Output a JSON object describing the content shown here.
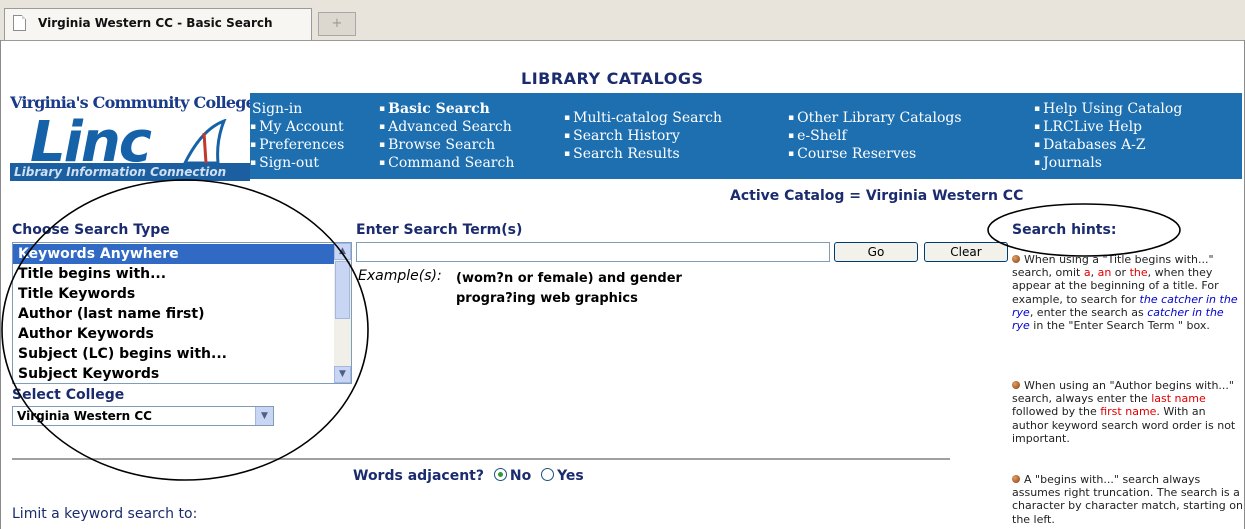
{
  "browser": {
    "tab_title": "Virginia Western CC - Basic Search",
    "new_tab": "+"
  },
  "logo": {
    "org": "Virginia's Community Colleges",
    "brand": "Linc",
    "tagline": "Library Information Connection"
  },
  "heading": "LIBRARY CATALOGS",
  "nav": {
    "col1": [
      "Sign-in",
      "My Account",
      "Preferences",
      "Sign-out"
    ],
    "col2": [
      "Basic Search",
      "Advanced Search",
      "Browse Search",
      "Command Search"
    ],
    "col3": [
      "Multi-catalog Search",
      "Search History",
      "Search Results"
    ],
    "col4": [
      "Other Library Catalogs",
      "e-Shelf",
      "Course Reserves"
    ],
    "col5": [
      "Help Using Catalog",
      "LRCLive Help",
      "Databases A-Z",
      "Journals"
    ]
  },
  "active_catalog": "Active Catalog = Virginia Western CC",
  "search_type": {
    "label": "Choose Search Type",
    "options": [
      "Keywords Anywhere",
      "Title begins with...",
      "Title Keywords",
      "Author (last name first)",
      "Author Keywords",
      "Subject (LC) begins with...",
      "Subject Keywords"
    ],
    "selected": "Keywords Anywhere"
  },
  "college": {
    "label": "Select College",
    "selected": "Virginia Western CC"
  },
  "search_term": {
    "label": "Enter Search Term(s)",
    "value": "",
    "go": "Go",
    "clear": "Clear"
  },
  "examples": {
    "label": "Example(s):",
    "items": [
      "(wom?n or female) and gender",
      "progra?ing web graphics"
    ]
  },
  "adjacent": {
    "label": "Words adjacent?",
    "options": [
      "No",
      "Yes"
    ],
    "selected": "No"
  },
  "limit_label": "Limit a keyword search to:",
  "hints": {
    "title": "Search hints:",
    "h1": {
      "a": "When using a  \"Title begins with...\" search, omit ",
      "r1": "a",
      "b": ", ",
      "r2": "an",
      "c": " or ",
      "r3": "the",
      "d": ", when they appear at the beginning of a title. For example, to search for ",
      "i1": "the catcher in the rye",
      "e": ", enter the search as ",
      "i2": "catcher in the rye",
      "f": " in the \"Enter Search Term \" box."
    },
    "h2": {
      "a": "When using an \"Author begins with...\" search, always enter the ",
      "r1": "last name",
      "b": " followed by the ",
      "r2": "first name",
      "c": ". With an author keyword search word order is not important."
    },
    "h3": {
      "a": "A \"begins with...\" search always assumes right truncation. The search is a character by character match, starting on the left."
    }
  },
  "colors": {
    "nav_bg": "#1e6fb0",
    "heading": "#1a2b6e",
    "selected": "#316ac5"
  }
}
